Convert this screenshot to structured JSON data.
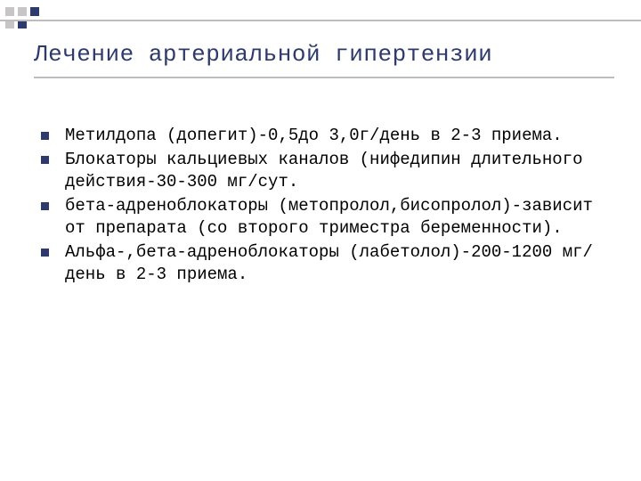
{
  "slide": {
    "title": "Лечение артериальной гипертензии",
    "bullets": [
      "Метилдопа (допегит)-0,5до 3,0г/день в 2-3 приема.",
      "Блокаторы кальциевых каналов (нифедипин длительного действия-30-300 мг/сут.",
      "бета-адреноблокаторы (метопролол,бисопролол)-зависит от препарата (со второго триместра беременности).",
      "Альфа-,бета-адреноблокаторы (лабетолол)-200-1200 мг/день в 2-3 приема."
    ]
  }
}
